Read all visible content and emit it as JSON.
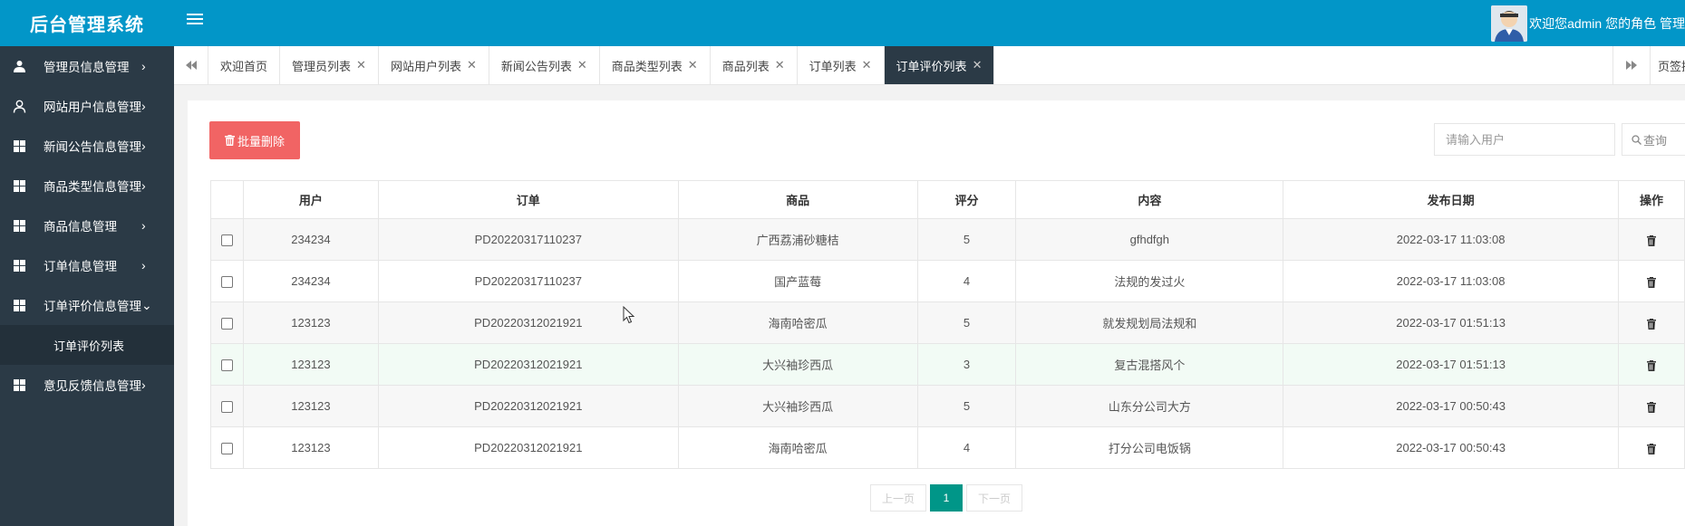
{
  "header": {
    "title": "后台管理系统",
    "user_text": "欢迎您admin 您的角色 管理"
  },
  "sidebar": {
    "items": [
      {
        "label": "管理员信息管理",
        "arrow": "›",
        "icon": "users-icon"
      },
      {
        "label": "网站用户信息管理",
        "arrow": "›",
        "icon": "user-icon"
      },
      {
        "label": "新闻公告信息管理",
        "arrow": "›",
        "icon": "grid-icon"
      },
      {
        "label": "商品类型信息管理",
        "arrow": "›",
        "icon": "grid-icon"
      },
      {
        "label": "商品信息管理",
        "arrow": "›",
        "icon": "grid-icon"
      },
      {
        "label": "订单信息管理",
        "arrow": "›",
        "icon": "grid-icon"
      },
      {
        "label": "订单评价信息管理",
        "arrow": "⌄",
        "icon": "grid-icon"
      },
      {
        "label": "意见反馈信息管理",
        "arrow": "›",
        "icon": "grid-icon"
      }
    ],
    "sub_item": "订单评价列表"
  },
  "tabs": {
    "items": [
      "欢迎首页",
      "管理员列表",
      "网站用户列表",
      "新闻公告列表",
      "商品类型列表",
      "商品列表",
      "订单列表",
      "订单评价列表"
    ],
    "close": "✕",
    "ops_label": "页签操作"
  },
  "toolbar": {
    "delete_label": "批量删除",
    "search_placeholder": "请输入用户",
    "search_label": "查询"
  },
  "table": {
    "headers": [
      "用户",
      "订单",
      "商品",
      "评分",
      "内容",
      "发布日期",
      "操作"
    ],
    "rows": [
      [
        "234234",
        "PD20220317110237",
        "广西荔浦砂糖桔",
        "5",
        "gfhdfgh",
        "2022-03-17 11:03:08"
      ],
      [
        "234234",
        "PD20220317110237",
        "国产蓝莓",
        "4",
        "法规的发过火",
        "2022-03-17 11:03:08"
      ],
      [
        "123123",
        "PD20220312021921",
        "海南哈密瓜",
        "5",
        "就发规划局法规和",
        "2022-03-17 01:51:13"
      ],
      [
        "123123",
        "PD20220312021921",
        "大兴袖珍西瓜",
        "3",
        "复古混搭风个",
        "2022-03-17 01:51:13"
      ],
      [
        "123123",
        "PD20220312021921",
        "大兴袖珍西瓜",
        "5",
        "山东分公司大方",
        "2022-03-17 00:50:43"
      ],
      [
        "123123",
        "PD20220312021921",
        "海南哈密瓜",
        "4",
        "打分公司电饭锅",
        "2022-03-17 00:50:43"
      ]
    ]
  },
  "pager": {
    "prev": "上一页",
    "current": "1",
    "next": "下一页"
  },
  "colors": {
    "header_bg": "#0296c8",
    "sidebar_bg": "#2b3a46",
    "delete_btn": "#f16464",
    "page_active": "#009688"
  }
}
